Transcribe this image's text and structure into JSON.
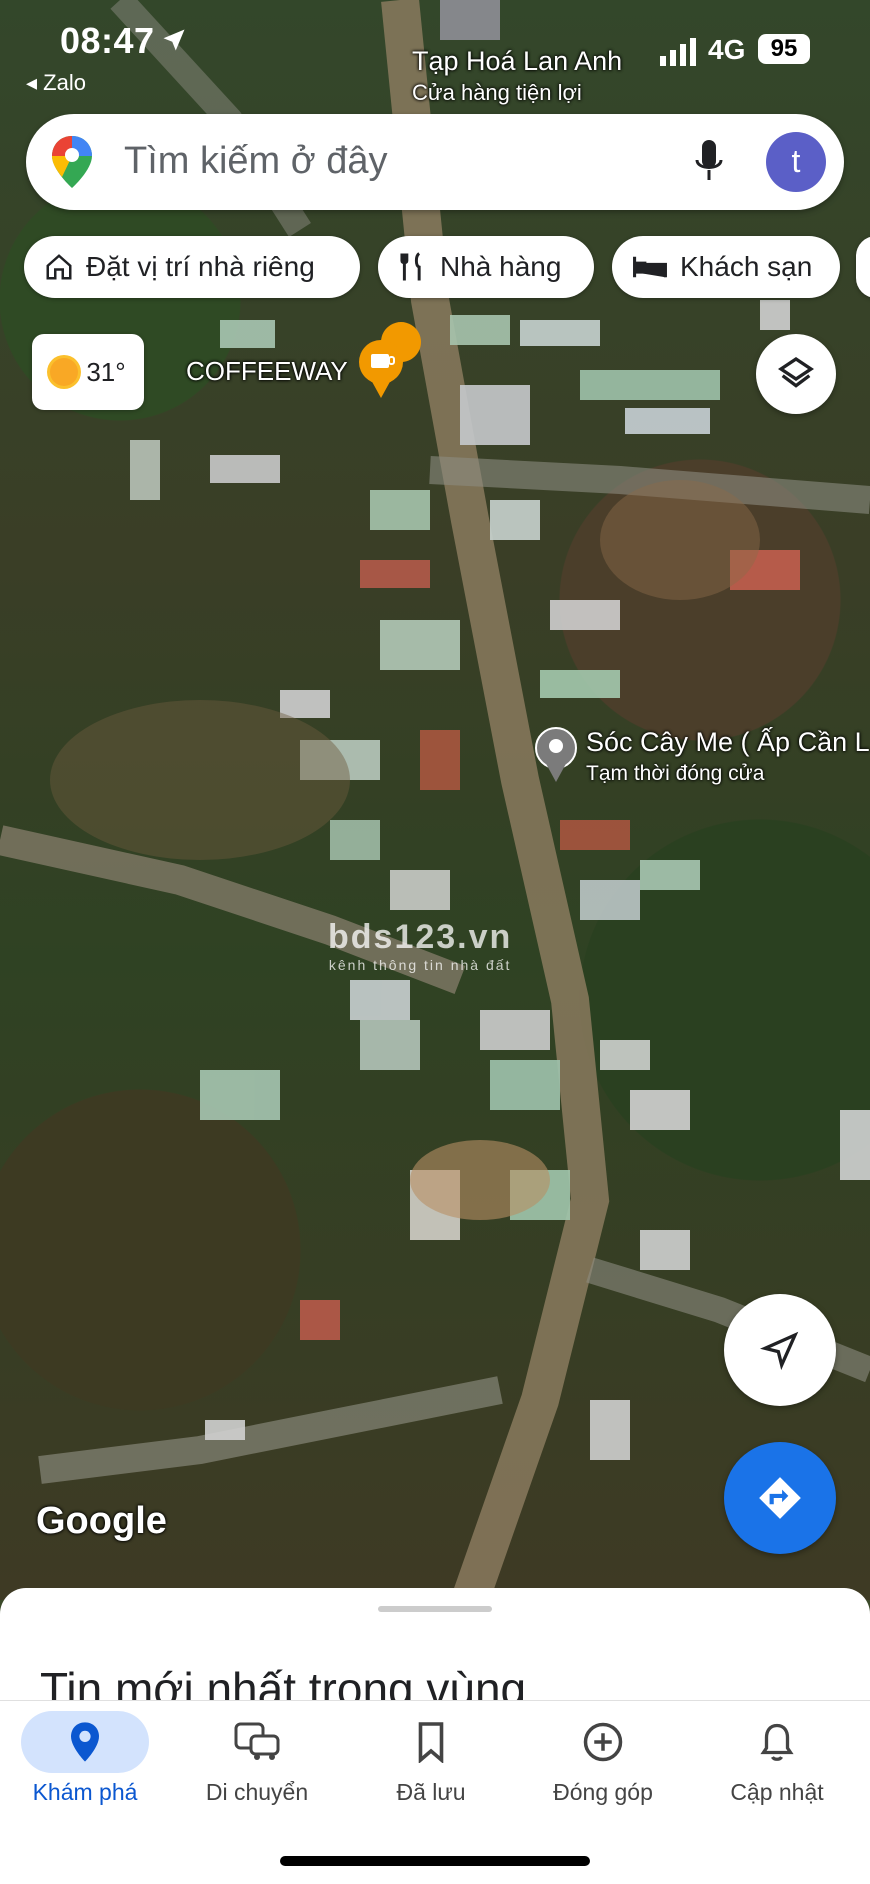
{
  "status_bar": {
    "time": "08:47",
    "back_app": "◂ Zalo",
    "network": "4G",
    "battery": "95"
  },
  "search": {
    "placeholder": "Tìm kiếm ở đây",
    "avatar_letter": "t"
  },
  "chips": [
    {
      "label": "Đặt vị trí nhà riêng",
      "icon": "home-icon"
    },
    {
      "label": "Nhà hàng",
      "icon": "restaurant-icon"
    },
    {
      "label": "Khách sạn",
      "icon": "hotel-icon"
    }
  ],
  "weather": {
    "temp": "31°"
  },
  "map_labels": {
    "shop_name": "Tạp Hoá Lan Anh",
    "shop_type": "Cửa hàng tiện lợi",
    "cafe": "COFFEEWAY",
    "place_name": "Sóc Cây Me ( Ấp Cần L",
    "place_status": "Tạm thời đóng cửa",
    "google": "Google"
  },
  "watermark": {
    "title": "bds123.vn",
    "subtitle": "kênh thông tin nhà đất"
  },
  "sheet": {
    "title": "Tin mới nhất trong vùng"
  },
  "nav": [
    {
      "label": "Khám phá",
      "icon": "explore-pin-icon",
      "active": true
    },
    {
      "label": "Di chuyển",
      "icon": "commute-icon",
      "active": false
    },
    {
      "label": "Đã lưu",
      "icon": "bookmark-icon",
      "active": false
    },
    {
      "label": "Đóng góp",
      "icon": "add-circle-icon",
      "active": false
    },
    {
      "label": "Cập nhật",
      "icon": "bell-icon",
      "active": false
    }
  ],
  "colors": {
    "accent": "#1a73e8",
    "nav_active": "#0b57d0",
    "nav_active_bg": "#d3e3fd",
    "avatar": "#5b5fc7"
  }
}
